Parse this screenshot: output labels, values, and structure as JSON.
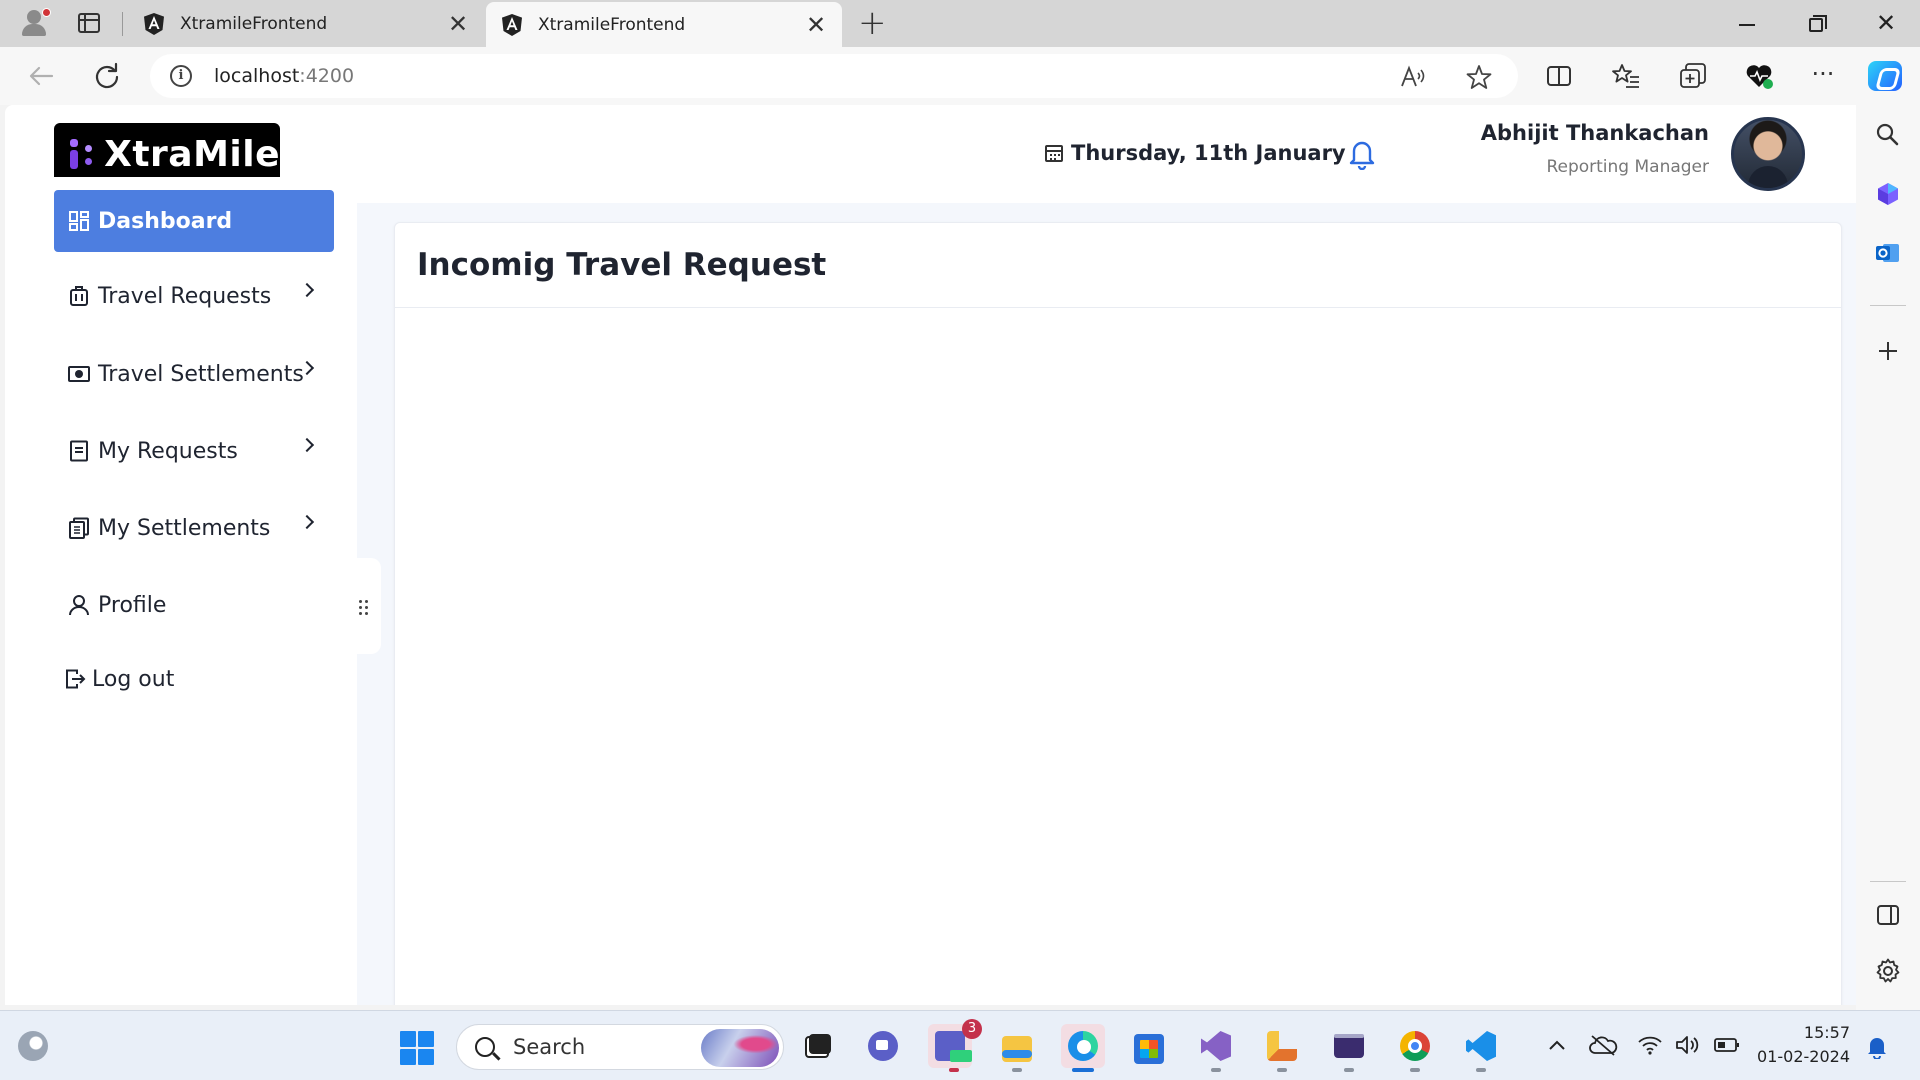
{
  "browser": {
    "tabs": [
      {
        "title": "XtramileFrontend",
        "active": false
      },
      {
        "title": "XtramileFrontend",
        "active": true
      }
    ],
    "close_glyph": "✕",
    "newtab_glyph": "+",
    "url_host": "localhost",
    "url_port": ":4200",
    "window_close_glyph": "✕"
  },
  "app": {
    "logo_text": "XtraMile",
    "date": "Thursday, 11th January",
    "user": {
      "name": "Abhijit Thankachan",
      "role": "Reporting Manager"
    },
    "accent_color": "#4d7ee0",
    "nav": [
      {
        "label": "Dashboard",
        "icon": "dashboard-icon",
        "active": true
      },
      {
        "label": "Travel Requests",
        "icon": "luggage-icon"
      },
      {
        "label": "Travel Settlements",
        "icon": "money-icon"
      },
      {
        "label": "My Requests",
        "icon": "document-icon"
      },
      {
        "label": "My Settlements",
        "icon": "receipt-icon"
      },
      {
        "label": "Profile",
        "icon": "user-icon"
      },
      {
        "label": "Log out",
        "icon": "logout-icon"
      }
    ],
    "main": {
      "title": "Incomig Travel Request"
    }
  },
  "taskbar": {
    "search_placeholder": "Search",
    "teams_badge": "3",
    "time": "15:57",
    "date": "01-02-2024"
  }
}
